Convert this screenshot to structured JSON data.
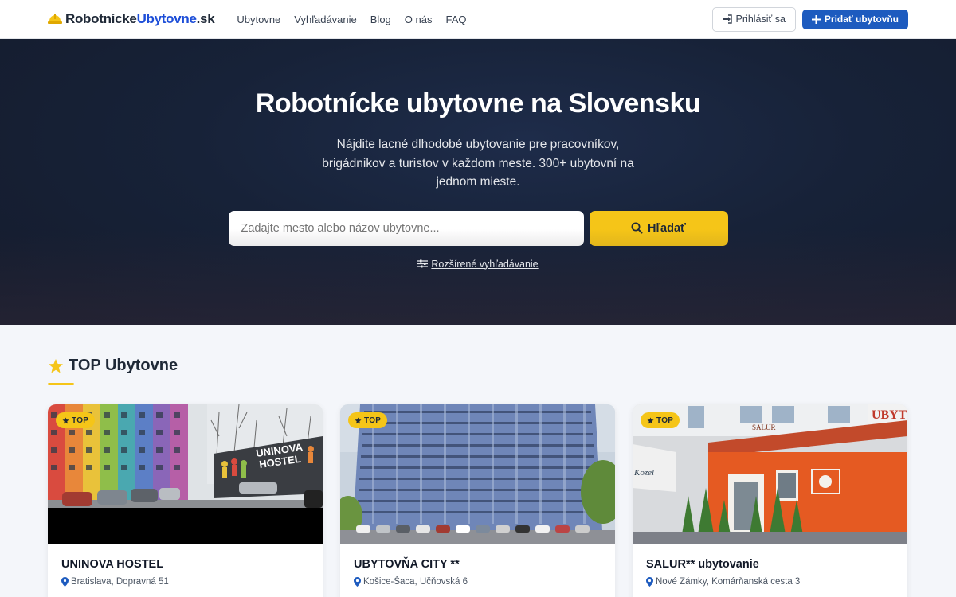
{
  "nav": {
    "logo_part1": "Robotnícke",
    "logo_part2": "Ubytovne",
    "logo_part3": ".sk",
    "menu": [
      "Ubytovne",
      "Vyhľadávanie",
      "Blog",
      "O nás",
      "FAQ"
    ],
    "login_label": "Prihlásiť sa",
    "add_label": "Pridať ubytovňu"
  },
  "hero": {
    "title": "Robotnícke ubytovne na Slovensku",
    "subtitle": "Nájdite lacné dlhodobé ubytovanie pre pracovníkov, brigádnikov a turistov v každom meste. 300+ ubytovní na jednom mieste.",
    "search_placeholder": "Zadajte mesto alebo názov ubytovne...",
    "search_button": "Hľadať",
    "advanced_link": "Rozšírené vyhľadávanie"
  },
  "top_section": {
    "title": "TOP Ubytovne",
    "cards": [
      {
        "badge": "TOP",
        "name": "UNINOVA HOSTEL",
        "address": "Bratislava, Dopravná 51",
        "sign_line1": "UNINOVA",
        "sign_line2": "HOSTEL"
      },
      {
        "badge": "TOP",
        "name": "UBYTOVŇA CITY **",
        "address": "Košice-Šaca, Učňovská 6"
      },
      {
        "badge": "TOP",
        "name": "SALUR** ubytovanie",
        "address": "Nové Zámky, Komárňanská cesta 3",
        "sign_text": "UBYT",
        "door_sign": "SALUR",
        "small_sign": "Kozel"
      }
    ]
  },
  "colors": {
    "brand_blue": "#1d5bbf",
    "accent_yellow": "#f5c518",
    "hero_dark": "#172238"
  }
}
